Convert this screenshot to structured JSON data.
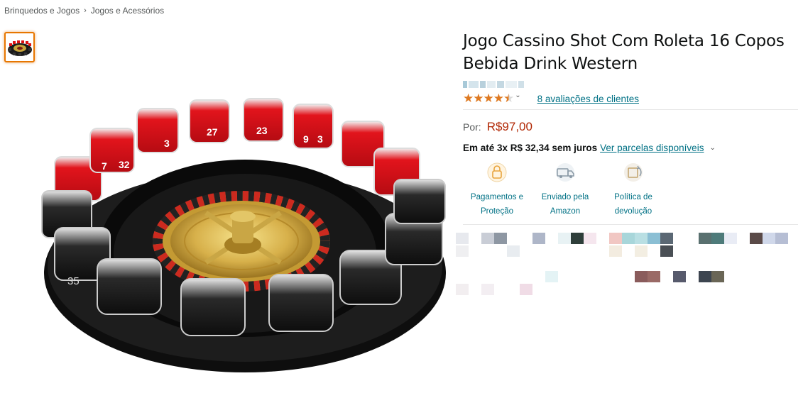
{
  "breadcrumb": {
    "items": [
      "Brinquedos e Jogos",
      "Jogos e Acessórios"
    ],
    "separator": "›"
  },
  "product": {
    "title_line1": "Jogo Cassino Shot Com Roleta 16 Copos",
    "title_line2": "Bebida Drink Western",
    "rating": 4.5,
    "rating_caret": "⌄",
    "reviews_text": "8 avaliações de clientes",
    "price_label": "Por:",
    "price": "R$97,00",
    "installments_bold": "Em até 3x R$ 32,34 sem juros",
    "installments_link": "Ver parcelas disponíveis",
    "installments_caret": "⌄"
  },
  "badges": [
    {
      "icon": "lock-icon",
      "line1": "Pagamentos e",
      "line2": "Proteção"
    },
    {
      "icon": "truck-icon",
      "line1": "Enviado pela",
      "line2": "Amazon"
    },
    {
      "icon": "return-box-icon",
      "line1": "Política de",
      "line2": "devolução"
    }
  ],
  "glass_numbers": [
    "7",
    "32",
    "3",
    "27",
    "23",
    "9",
    "3",
    "35"
  ],
  "colors": {
    "accent_orange": "#e77600",
    "star": "#de7921",
    "link": "#007185",
    "price": "#b12704",
    "text": "#0f1111",
    "muted": "#565959"
  }
}
